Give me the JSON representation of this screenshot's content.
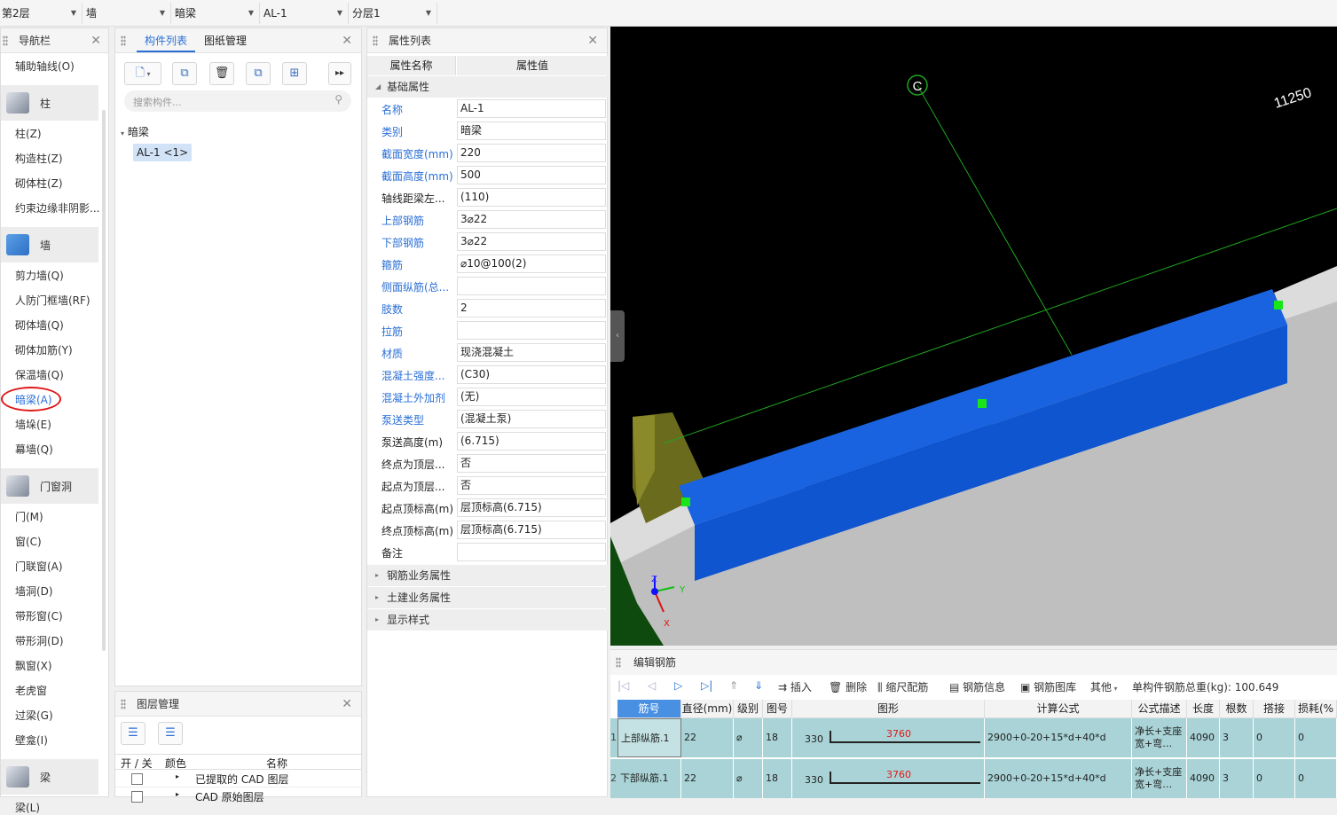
{
  "topbar": {
    "floor": "第2层",
    "type": "墙",
    "subtype": "暗梁",
    "component": "AL-1",
    "layer": "分层1"
  },
  "nav": {
    "title": "导航栏",
    "items": [
      {
        "label": "辅助轴线(O)"
      },
      {
        "category": "柱"
      },
      {
        "label": "柱(Z)"
      },
      {
        "label": "构造柱(Z)"
      },
      {
        "label": "砌体柱(Z)"
      },
      {
        "label": "约束边缘非阴影..."
      },
      {
        "category": "墙"
      },
      {
        "label": "剪力墙(Q)"
      },
      {
        "label": "人防门框墙(RF)"
      },
      {
        "label": "砌体墙(Q)"
      },
      {
        "label": "砌体加筋(Y)"
      },
      {
        "label": "保温墙(Q)"
      },
      {
        "label": "暗梁(A)"
      },
      {
        "label": "墙垛(E)"
      },
      {
        "label": "幕墙(Q)"
      },
      {
        "category": "门窗洞"
      },
      {
        "label": "门(M)"
      },
      {
        "label": "窗(C)"
      },
      {
        "label": "门联窗(A)"
      },
      {
        "label": "墙洞(D)"
      },
      {
        "label": "带形窗(C)"
      },
      {
        "label": "带形洞(D)"
      },
      {
        "label": "飘窗(X)"
      },
      {
        "label": "老虎窗"
      },
      {
        "label": "过梁(G)"
      },
      {
        "label": "壁龛(I)"
      },
      {
        "category": "梁"
      },
      {
        "label": "梁(L)"
      }
    ]
  },
  "components": {
    "tab_active": "构件列表",
    "tab_other": "图纸管理",
    "search_placeholder": "搜索构件...",
    "tree_root": "暗梁",
    "tree_item": "AL-1 <1>"
  },
  "layers": {
    "title": "图层管理",
    "col_toggle": "开 / 关",
    "col_color": "颜色",
    "col_name": "名称",
    "rows": [
      "已提取的 CAD 图层",
      "CAD 原始图层"
    ]
  },
  "props": {
    "title": "属性列表",
    "col_name": "属性名称",
    "col_value": "属性值",
    "group_basic": "基础属性",
    "rows": [
      {
        "name": "名称",
        "value": "AL-1",
        "blue": true
      },
      {
        "name": "类别",
        "value": "暗梁",
        "blue": true
      },
      {
        "name": "截面宽度(mm)",
        "value": "220",
        "blue": true
      },
      {
        "name": "截面高度(mm)",
        "value": "500",
        "blue": true
      },
      {
        "name": "轴线距梁左...",
        "value": "(110)",
        "blue": false
      },
      {
        "name": "上部钢筋",
        "value": "3⌀22",
        "blue": true
      },
      {
        "name": "下部钢筋",
        "value": "3⌀22",
        "blue": true
      },
      {
        "name": "箍筋",
        "value": "⌀10@100(2)",
        "blue": true
      },
      {
        "name": "侧面纵筋(总...",
        "value": "",
        "blue": true
      },
      {
        "name": "肢数",
        "value": "2",
        "blue": true
      },
      {
        "name": "拉筋",
        "value": "",
        "blue": true
      },
      {
        "name": "材质",
        "value": "现浇混凝土",
        "blue": true
      },
      {
        "name": "混凝土强度...",
        "value": "(C30)",
        "blue": true
      },
      {
        "name": "混凝土外加剂",
        "value": "(无)",
        "blue": true
      },
      {
        "name": "泵送类型",
        "value": "(混凝土泵)",
        "blue": true
      },
      {
        "name": "泵送高度(m)",
        "value": "(6.715)",
        "blue": false
      },
      {
        "name": "终点为顶层...",
        "value": "否",
        "blue": false
      },
      {
        "name": "起点为顶层...",
        "value": "否",
        "blue": false
      },
      {
        "name": "起点顶标高(m)",
        "value": "层顶标高(6.715)",
        "blue": false
      },
      {
        "name": "终点顶标高(m)",
        "value": "层顶标高(6.715)",
        "blue": false
      },
      {
        "name": "备注",
        "value": "",
        "blue": false
      }
    ],
    "groups_collapsed": [
      "钢筋业务属性",
      "土建业务属性",
      "显示样式"
    ]
  },
  "viewport": {
    "axis_label": "C",
    "dimension": "11250",
    "axis_x": "X",
    "axis_y": "Y",
    "axis_z": "Z"
  },
  "rebar": {
    "title": "编辑钢筋",
    "tools": [
      "插入",
      "删除",
      "缩尺配筋",
      "钢筋信息",
      "钢筋图库",
      "其他"
    ],
    "total_label": "单构件钢筋总重(kg): 100.649",
    "headers": [
      "筋号",
      "直径(mm)",
      "级别",
      "图号",
      "图形",
      "计算公式",
      "公式描述",
      "长度",
      "根数",
      "搭接",
      "损耗(%"
    ],
    "rows": [
      {
        "idx": "1",
        "name": "上部纵筋.1",
        "dia": "22",
        "grade": "⌀",
        "fig": "18",
        "left": "330",
        "shape": "3760",
        "formula": "2900+0-20+15*d+40*d",
        "desc": "净长+支座宽+弯…",
        "length": "4090",
        "count": "3",
        "lap": "0",
        "loss": "0"
      },
      {
        "idx": "2",
        "name": "下部纵筋.1",
        "dia": "22",
        "grade": "⌀",
        "fig": "18",
        "left": "330",
        "shape": "3760",
        "formula": "2900+0-20+15*d+40*d",
        "desc": "净长+支座宽+弯…",
        "length": "4090",
        "count": "3",
        "lap": "0",
        "loss": "0"
      }
    ]
  }
}
